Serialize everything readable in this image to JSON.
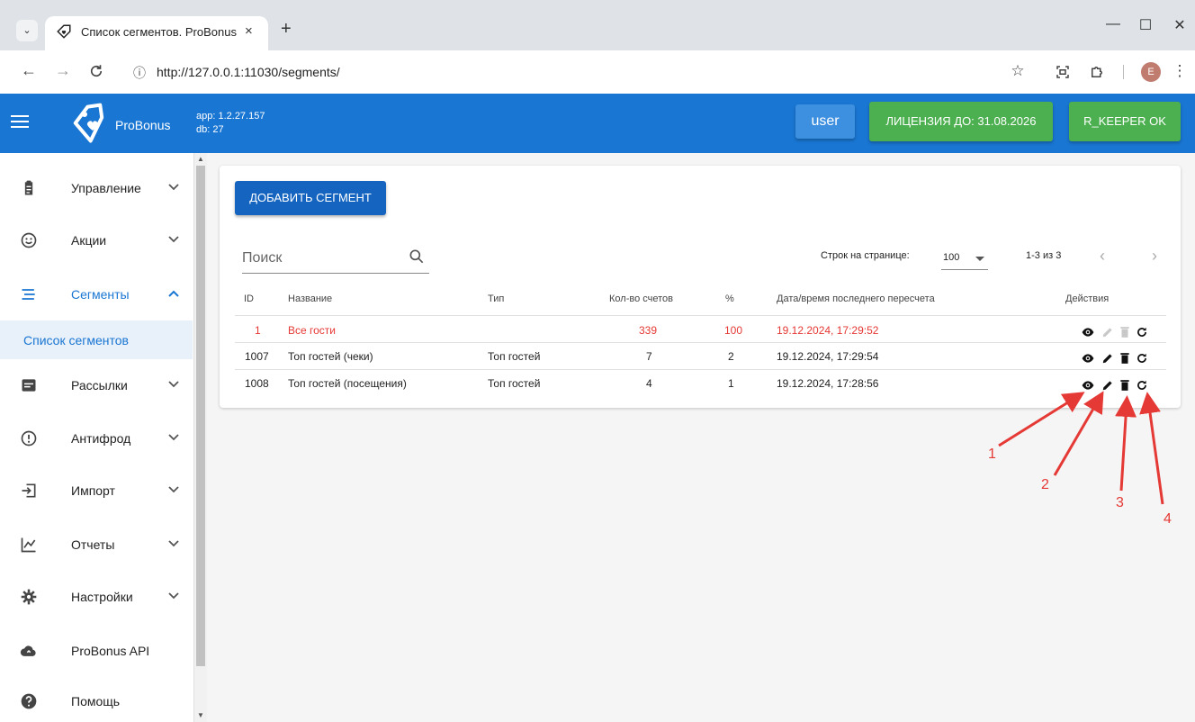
{
  "browser": {
    "tab_title": "Список сегментов. ProBonus",
    "tab_close": "×",
    "new_tab": "+",
    "url": "http://127.0.0.1:11030/segments/",
    "profile_initial": "E",
    "window_controls": [
      "—",
      "☐",
      "✕"
    ]
  },
  "header": {
    "brand": "ProBonus",
    "app_version": "app: 1.2.27.157",
    "db_version": "db: 27",
    "user_label": "user",
    "license_label": "ЛИЦЕНЗИЯ ДО: 31.08.2026",
    "rkeeper_label": "R_KEEPER OK",
    "colors": {
      "primary": "#1976d2",
      "success": "#4caf50",
      "user_btn": "#3d8fe0"
    }
  },
  "sidebar": {
    "items": [
      {
        "label": "Управление",
        "icon": "clipboard-icon",
        "has_chevron": true
      },
      {
        "label": "Акции",
        "icon": "smile-icon",
        "has_chevron": true
      },
      {
        "label": "Сегменты",
        "icon": "list-icon",
        "has_chevron": true,
        "expanded": true
      },
      {
        "label": "Рассылки",
        "icon": "mail-icon",
        "has_chevron": true
      },
      {
        "label": "Антифрод",
        "icon": "alert-icon",
        "has_chevron": true
      },
      {
        "label": "Импорт",
        "icon": "import-icon",
        "has_chevron": true
      },
      {
        "label": "Отчеты",
        "icon": "chart-icon",
        "has_chevron": true
      },
      {
        "label": "Настройки",
        "icon": "gear-icon",
        "has_chevron": true
      },
      {
        "label": "ProBonus API",
        "icon": "cloud-icon",
        "has_chevron": false
      },
      {
        "label": "Помощь",
        "icon": "help-icon",
        "has_chevron": false
      }
    ],
    "sub_item": "Список сегментов"
  },
  "main": {
    "add_button": "ДОБАВИТЬ СЕГМЕНТ",
    "search_placeholder": "Поиск",
    "rows_per_page_label": "Строк на странице:",
    "rows_per_page_value": "100",
    "page_range": "1-3 из 3",
    "columns": [
      "ID",
      "Название",
      "Тип",
      "Кол-во счетов",
      "%",
      "Дата/время последнего пересчета",
      "Действия"
    ],
    "rows": [
      {
        "id": "1",
        "name": "Все гости",
        "type": "",
        "count": "339",
        "percent": "100",
        "date": "19.12.2024, 17:29:52",
        "highlight": true
      },
      {
        "id": "1007",
        "name": "Топ гостей (чеки)",
        "type": "Топ гостей",
        "count": "7",
        "percent": "2",
        "date": "19.12.2024, 17:29:54",
        "highlight": false
      },
      {
        "id": "1008",
        "name": "Топ гостей (посещения)",
        "type": "Топ гостей",
        "count": "4",
        "percent": "1",
        "date": "19.12.2024, 17:28:56",
        "highlight": false
      }
    ]
  },
  "annotations": [
    "1",
    "2",
    "3",
    "4"
  ]
}
